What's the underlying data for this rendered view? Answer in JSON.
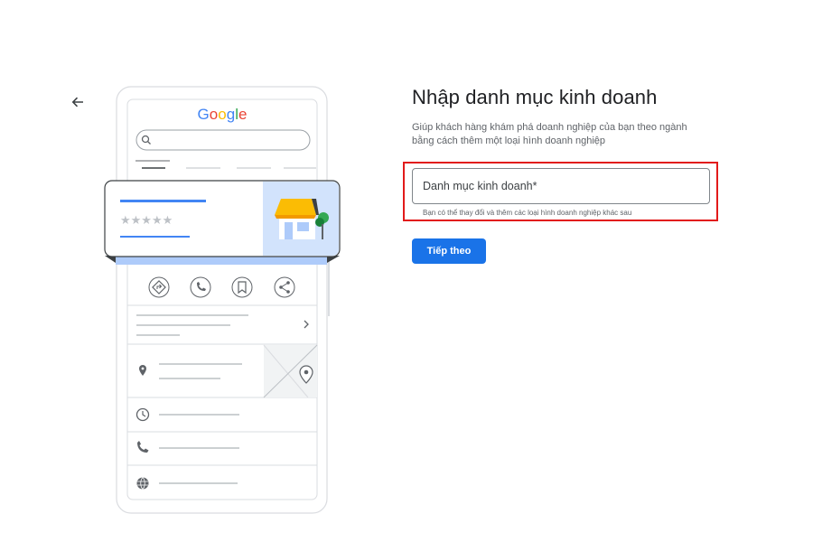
{
  "nav": {
    "back_icon": "arrow-left-icon"
  },
  "illustration": {
    "logo_text": "Google",
    "logo_colors": [
      "#4285F4",
      "#EA4335",
      "#FBBC05",
      "#4285F4",
      "#34A853",
      "#EA4335"
    ],
    "rating_stars": "★★★★★",
    "action_icons": [
      "directions-icon",
      "phone-icon",
      "bookmark-icon",
      "share-icon"
    ],
    "detail_icons": [
      "location-pin-icon",
      "clock-icon",
      "phone-icon",
      "globe-icon"
    ]
  },
  "page": {
    "title": "Nhập danh mục kinh doanh",
    "subtitle": "Giúp khách hàng khám phá doanh nghiệp của bạn theo ngành bằng cách thêm một loại hình doanh nghiệp"
  },
  "category_field": {
    "label": "Danh mục kinh doanh*",
    "value": "",
    "helper": "Bạn có thể thay đổi và thêm các loại hình doanh nghiệp khác sau"
  },
  "next_button": {
    "label": "Tiếp theo"
  },
  "colors": {
    "accent": "#1a73e8",
    "highlight": "#e21a1a",
    "awning": "#fbbc04",
    "tree": "#34a853",
    "store_bg": "#d2e3fc"
  }
}
